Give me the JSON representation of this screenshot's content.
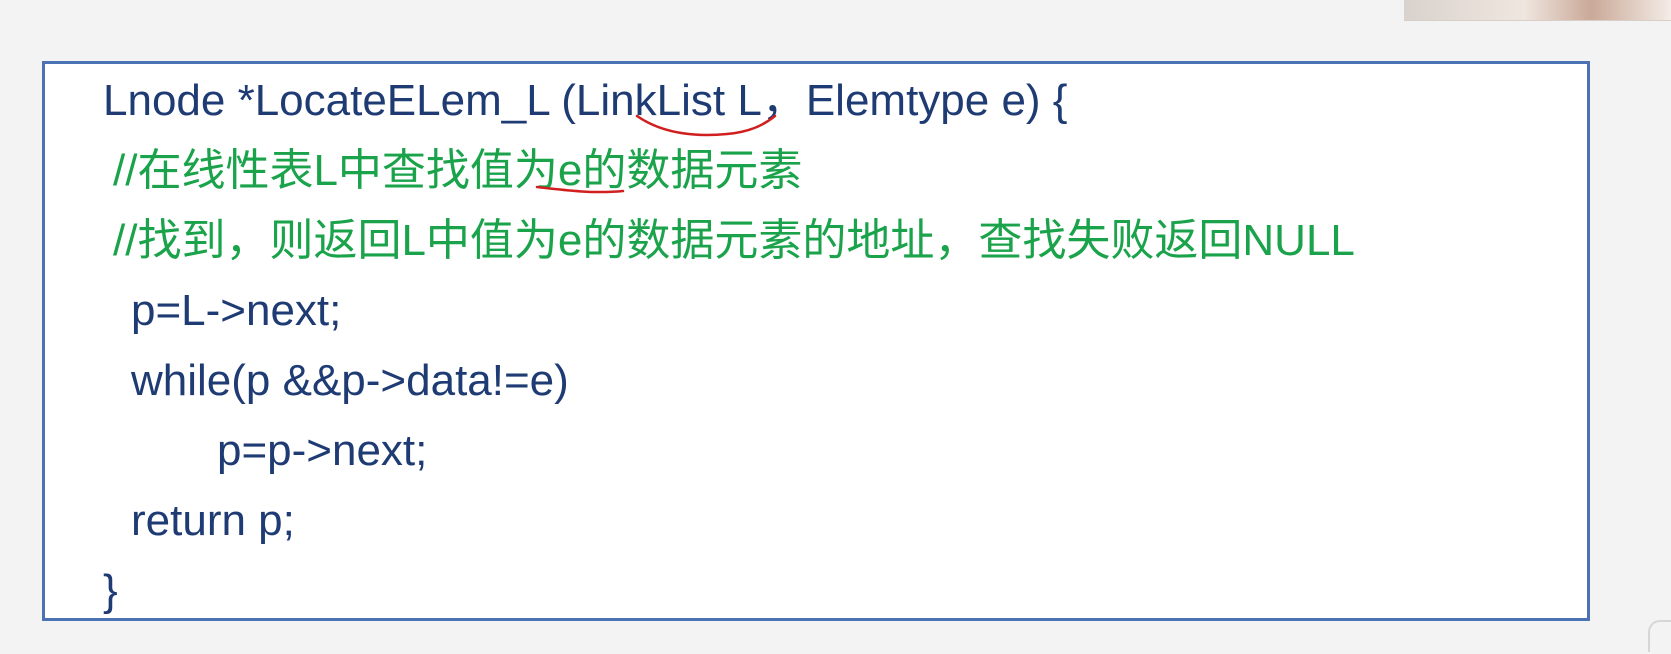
{
  "code_lines": [
    {
      "text": "Lnode *LocateELem_L (LinkList L，Elemtype e) {",
      "kind": "code"
    },
    {
      "text": "//在线性表L中查找值为e的数据元素",
      "kind": "comment"
    },
    {
      "text": "//找到，则返回L中值为e的数据元素的地址，查找失败返回NULL",
      "kind": "comment"
    },
    {
      "text": "p=L->next;",
      "kind": "code"
    },
    {
      "text": "while(p &&p->data!=e)",
      "kind": "code"
    },
    {
      "text": "p=p->next;",
      "kind": "code"
    },
    {
      "text": "return p;",
      "kind": "code"
    },
    {
      "text": "}",
      "kind": "code"
    }
  ],
  "colors": {
    "code": "#1f3b73",
    "comment": "#1aa34a",
    "border": "#4a72b4",
    "annotation": "#d11f1f"
  }
}
